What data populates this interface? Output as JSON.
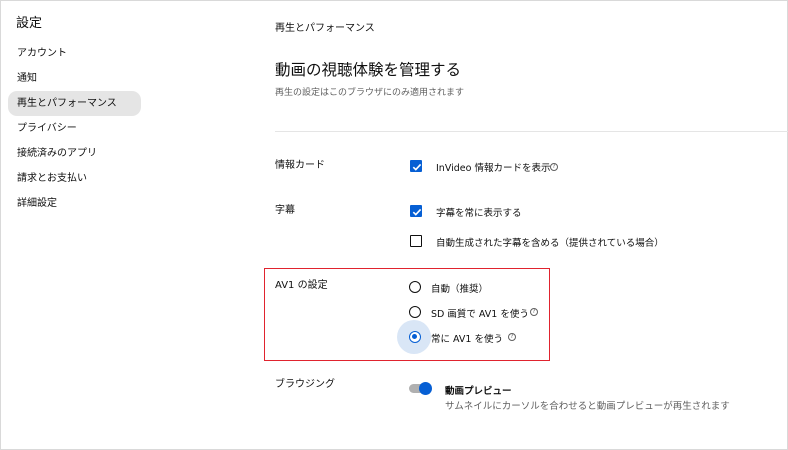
{
  "sidebar": {
    "title": "設定",
    "items": [
      {
        "label": "アカウント"
      },
      {
        "label": "通知"
      },
      {
        "label": "再生とパフォーマンス"
      },
      {
        "label": "プライバシー"
      },
      {
        "label": "接続済みのアプリ"
      },
      {
        "label": "請求とお支払い"
      },
      {
        "label": "詳細設定"
      }
    ],
    "active_index": 2
  },
  "main": {
    "breadcrumb": "再生とパフォーマンス",
    "title": "動画の視聴体験を管理する",
    "subtitle": "再生の設定はこのブラウザにのみ適用されます",
    "info_cards": {
      "label": "情報カード",
      "option": {
        "label": "InVideo 情報カードを表示",
        "checked": true
      }
    },
    "captions": {
      "label": "字幕",
      "options": [
        {
          "label": "字幕を常に表示する",
          "checked": true
        },
        {
          "label": "自動生成された字幕を含める（提供されている場合）",
          "checked": false
        }
      ]
    },
    "av1": {
      "label": "AV1 の設定",
      "options": [
        {
          "label": "自動（推奨）",
          "selected": false
        },
        {
          "label": "SD 画質で AV1 を使う",
          "selected": false
        },
        {
          "label": "常に AV1 を使う",
          "selected": true
        }
      ]
    },
    "browsing": {
      "label": "ブラウジング",
      "toggle_on": true,
      "preview_title": "動画プレビュー",
      "preview_desc": "サムネイルにカーソルを合わせると動画プレビューが再生されます"
    },
    "help_glyph": "?"
  },
  "colors": {
    "accent": "#065fd4",
    "highlight": "#e0232e",
    "active_bg": "#e5e5e5"
  }
}
